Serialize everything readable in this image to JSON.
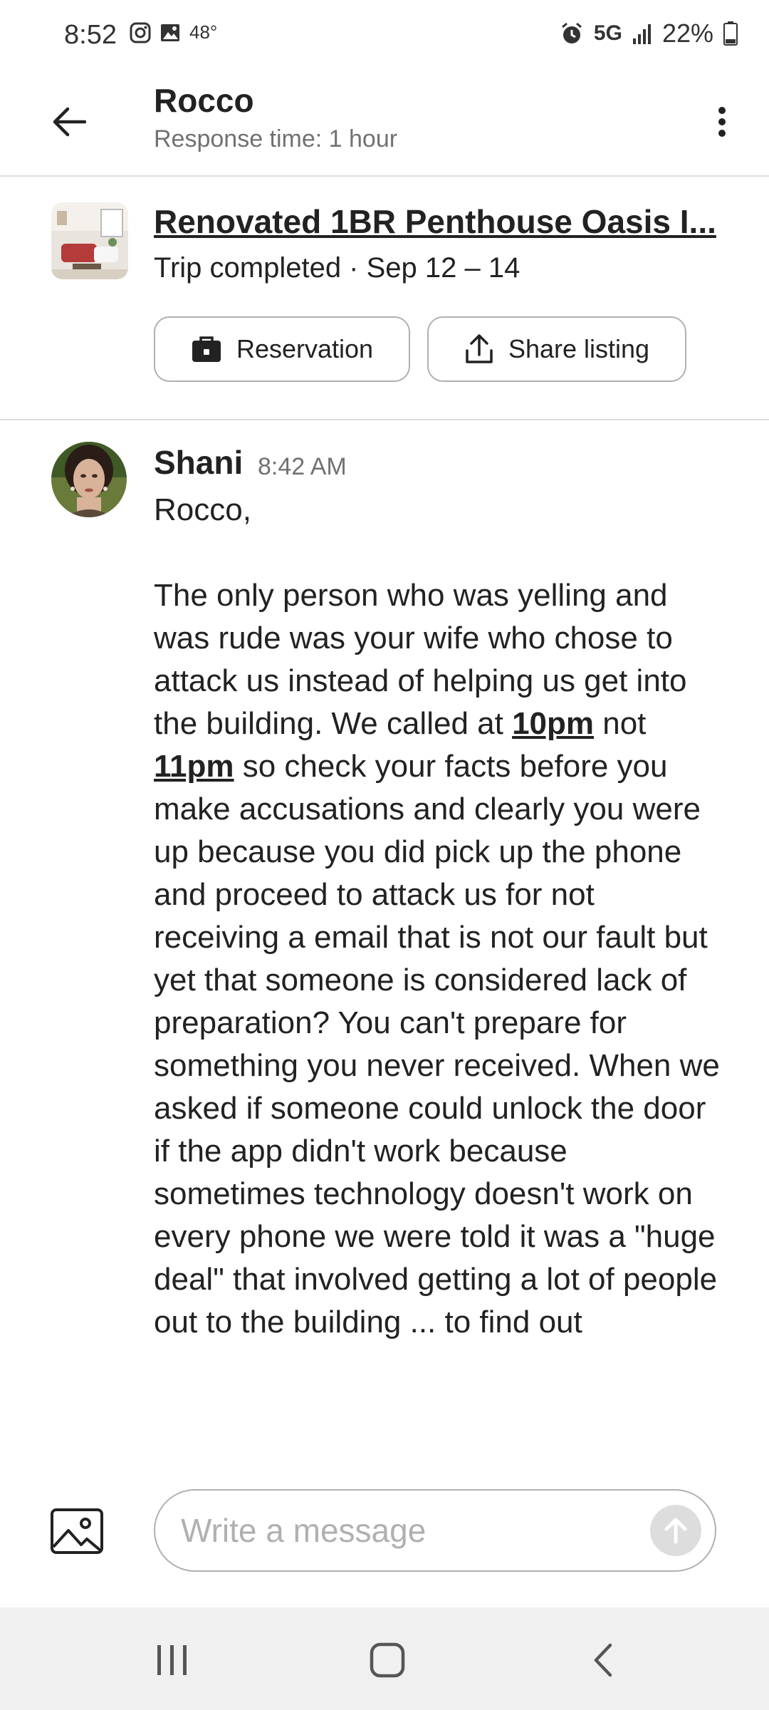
{
  "status_bar": {
    "time": "8:52",
    "temperature": "48°",
    "network": "5G",
    "battery": "22%"
  },
  "header": {
    "host_name": "Rocco",
    "response_time": "Response time: 1 hour"
  },
  "listing": {
    "title": "Renovated 1BR Penthouse Oasis I...",
    "trip_status": "Trip completed · Sep 12 – 14",
    "reservation_label": "Reservation",
    "share_label": "Share listing"
  },
  "message": {
    "sender": "Shani",
    "time": "8:42 AM",
    "greeting": "Rocco,",
    "body_part1": "The only person who was yelling and was rude was your wife who chose to attack us instead of helping us get into the building. We called at ",
    "highlight1": "10pm",
    "body_part2": " not ",
    "highlight2": "11pm",
    "body_part3": " so check your facts before you make accusations and clearly you were up because you did pick up the phone and proceed to attack us for not receiving a email that is not our fault but yet that someone is considered lack of preparation? You can't prepare for something you never received. When we asked if someone could unlock the door if the app didn't work because sometimes technology doesn't work on every phone we were told it was a \"huge deal\" that involved getting a lot of people out to the building ... to find out"
  },
  "composer": {
    "placeholder": "Write a message"
  },
  "colors": {
    "text_primary": "#222222",
    "text_secondary": "#717171",
    "border": "#b0b0b0",
    "send_disabled": "#dddddd"
  }
}
